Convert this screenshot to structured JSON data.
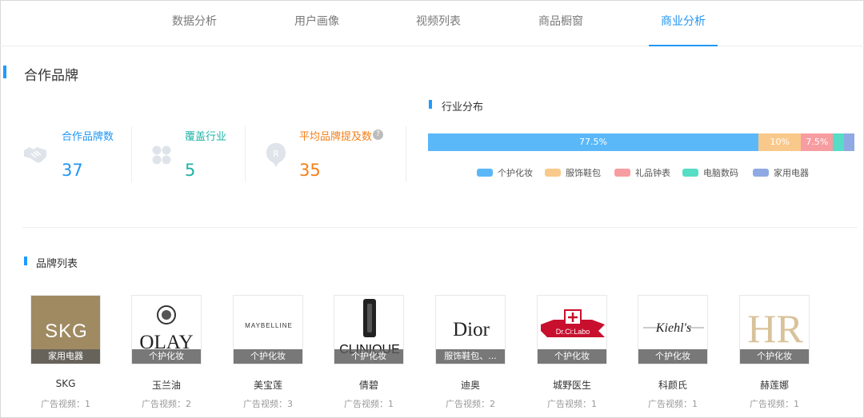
{
  "tabs": [
    "数据分析",
    "用户画像",
    "视频列表",
    "商品橱窗",
    "商业分析"
  ],
  "active_tab": "商业分析",
  "section": {
    "title": "合作品牌"
  },
  "stats": [
    {
      "label": "合作品牌数",
      "value": "37",
      "color": "#2196f3",
      "icon": "handshake-icon"
    },
    {
      "label": "覆盖行业",
      "value": "5",
      "color": "#20b2a6",
      "icon": "grid-icon"
    },
    {
      "label": "平均品牌提及数",
      "value": "35",
      "color": "#f57f17",
      "icon": "registered-badge-icon",
      "help": "?"
    }
  ],
  "industry": {
    "title": "行业分布",
    "segments": [
      {
        "name": "个护化妆",
        "label": "77.5%",
        "share": 77.5,
        "color": "#5ab8f8"
      },
      {
        "name": "服饰鞋包",
        "label": "10%",
        "share": 10,
        "color": "#f9c98b"
      },
      {
        "name": "礼品钟表",
        "label": "7.5%",
        "share": 7.5,
        "color": "#f79da1"
      },
      {
        "name": "电脑数码",
        "label": "",
        "share": 2.5,
        "color": "#55ddc6"
      },
      {
        "name": "家用电器",
        "label": "",
        "share": 2.5,
        "color": "#8fa9e3"
      }
    ]
  },
  "brand_list": {
    "title": "品牌列表",
    "brands": [
      {
        "name": "SKG",
        "tag": "家用电器",
        "count": "广告视频：1",
        "logo": "SKG"
      },
      {
        "name": "玉兰油",
        "tag": "个护化妆",
        "count": "广告视频：2",
        "logo": "OLAY"
      },
      {
        "name": "美宝莲",
        "tag": "个护化妆",
        "count": "广告视频：3",
        "logo": "MAYBELLINE"
      },
      {
        "name": "倩碧",
        "tag": "个护化妆",
        "count": "广告视频：1",
        "logo": "CLINIQUE"
      },
      {
        "name": "迪奥",
        "tag": "服饰鞋包、...",
        "count": "广告视频：2",
        "logo": "Dior"
      },
      {
        "name": "城野医生",
        "tag": "个护化妆",
        "count": "广告视频：1",
        "logo": "Dr.Ci:Labo"
      },
      {
        "name": "科颜氏",
        "tag": "个护化妆",
        "count": "广告视频：1",
        "logo": "Kiehl's"
      },
      {
        "name": "赫莲娜",
        "tag": "个护化妆",
        "count": "广告视频：1",
        "logo": "HR"
      }
    ]
  }
}
